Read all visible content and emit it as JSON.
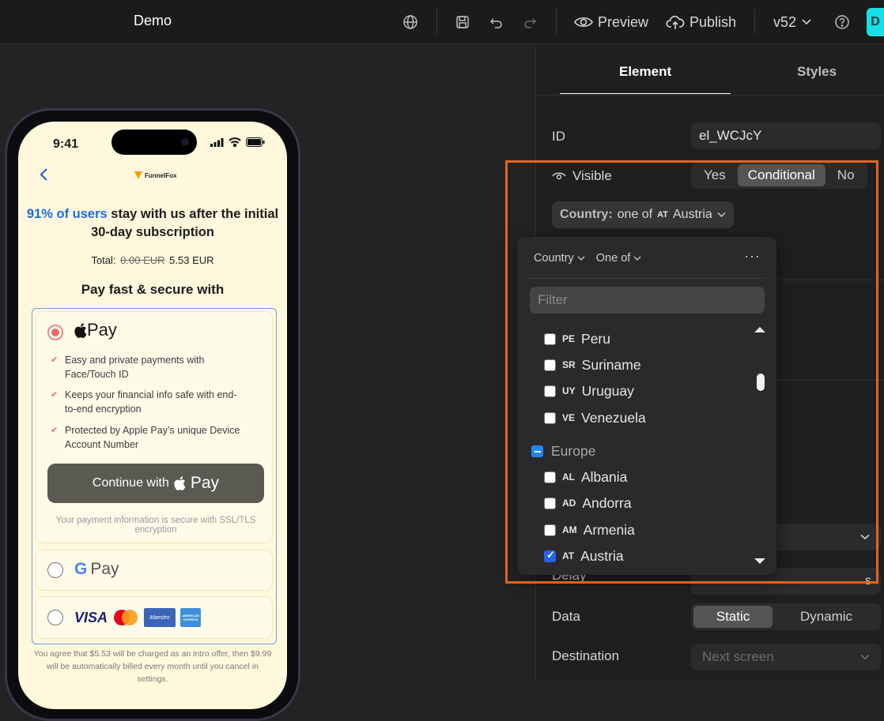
{
  "app": {
    "title": "Demo",
    "preview_label": "Preview",
    "publish_label": "Publish",
    "version": "v52",
    "cyan_letter": "D"
  },
  "phone": {
    "time": "9:41",
    "brand": "FunnelFox",
    "headline_highlight": "91% of users",
    "headline_rest": " stay with us after the initial 30-day subscription",
    "total_label": "Total:",
    "total_old": "0.00 EUR",
    "total_new": "5.53 EUR",
    "pay_title": "Pay fast & secure with",
    "apple_pay_word": "Pay",
    "bullets": [
      "Easy and private payments with Face/Touch ID",
      "Keeps your financial info safe with end-to-end encryption",
      "Protected by Apple Pay’s unique Device Account Number"
    ],
    "continue_label": "Continue with",
    "continue_pay": "Pay",
    "secure_note": "Your payment information is secure with SSL/TLS encryption",
    "gpay_g": "G",
    "gpay_word": "Pay",
    "card_visa": "VISA",
    "card_maestro": "Maestro",
    "card_amex": "AMERICAN EXPRESS",
    "legal": "You agree that $5.53 will be charged as an intro offer, then $9.99 will be automatically billed every month until you cancel in settings."
  },
  "panel": {
    "tab_element": "Element",
    "tab_styles": "Styles",
    "id_label": "ID",
    "id_value": "el_WCJcY",
    "visible_label": "Visible",
    "visible_options": [
      "Yes",
      "Conditional",
      "No"
    ],
    "condition_key": "Country:",
    "condition_op": "one of",
    "condition_code": "AT",
    "condition_value": "Austria",
    "delay_label": "Delay",
    "delay_unit": "s",
    "data_label": "Data",
    "data_options": [
      "Static",
      "Dynamic"
    ],
    "destination_label": "Destination",
    "destination_placeholder": "Next screen"
  },
  "popover": {
    "field": "Country",
    "operator": "One of",
    "filter_placeholder": "Filter",
    "options_top": [
      {
        "code": "PE",
        "name": "Peru",
        "checked": false
      },
      {
        "code": "SR",
        "name": "Suriname",
        "checked": false
      },
      {
        "code": "UY",
        "name": "Uruguay",
        "checked": false
      },
      {
        "code": "VE",
        "name": "Venezuela",
        "checked": false
      }
    ],
    "group": "Europe",
    "options_europe": [
      {
        "code": "AL",
        "name": "Albania",
        "checked": false
      },
      {
        "code": "AD",
        "name": "Andorra",
        "checked": false
      },
      {
        "code": "AM",
        "name": "Armenia",
        "checked": false
      },
      {
        "code": "AT",
        "name": "Austria",
        "checked": true
      }
    ]
  },
  "colors": {
    "accent_blue": "#1e6be6",
    "highlight_orange": "#e2641f",
    "phone_bg": "#fff8dc",
    "cyan": "#14e0e6"
  }
}
